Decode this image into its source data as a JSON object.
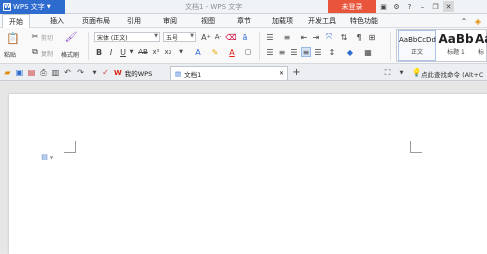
{
  "titlebar": {
    "app_name": "WPS 文字",
    "document_title": "文档1 - WPS 文字",
    "login_label": "未登录"
  },
  "menu": {
    "tabs": [
      "开始",
      "插入",
      "页面布局",
      "引用",
      "审阅",
      "视图",
      "章节",
      "加载项",
      "开发工具",
      "特色功能"
    ],
    "active_tab": "开始"
  },
  "ribbon": {
    "paste_label": "粘贴",
    "cut_label": "剪切",
    "copy_label": "复制",
    "format_painter_label": "格式刷",
    "font_name": "宋体 (正文)",
    "font_size": "五号",
    "styles": [
      {
        "sample": "AaBbCcDd",
        "name": "正文"
      },
      {
        "sample": "AaBb",
        "name": "标题 1"
      },
      {
        "sample": "Aa",
        "name": "标"
      }
    ]
  },
  "quickbar": {
    "tabs": [
      {
        "label": "我的WPS"
      },
      {
        "label": "文档1"
      }
    ],
    "command_search": "点此查找命令 (Alt+C"
  }
}
